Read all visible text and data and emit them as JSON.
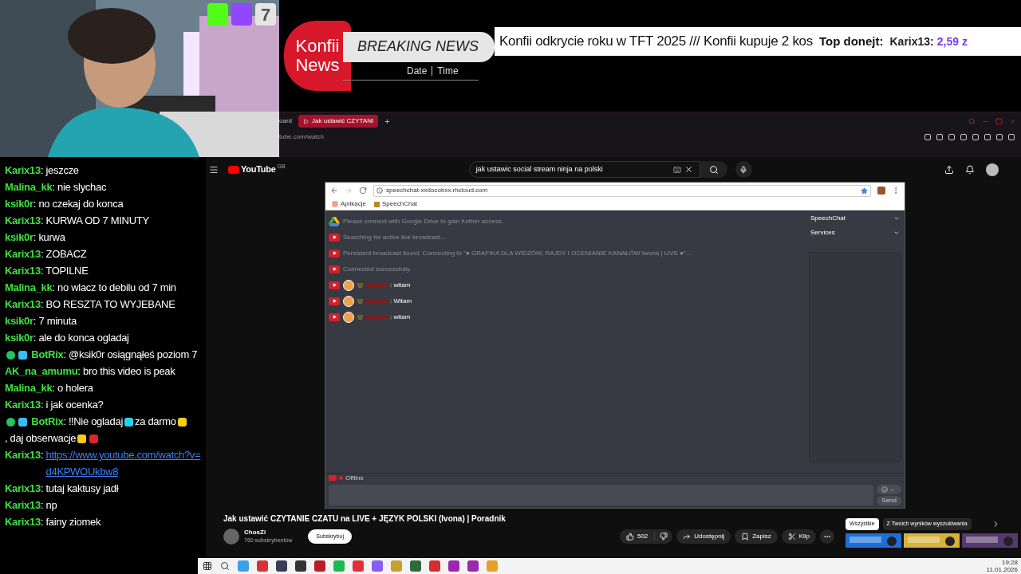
{
  "webcam": {
    "kind": "picture",
    "badge_count": "7"
  },
  "ticker": {
    "brand_top": "Konfii",
    "brand_bottom": "News",
    "headline": "BREAKING NEWS",
    "date": "Date",
    "time": "Time",
    "news": "Konfii odkrycie roku w TFT 2025  /// Konfii kupuje 2 kos",
    "top_label": "Top donejt:",
    "top_name": "Karix13:",
    "top_amount": "2,59 z"
  },
  "browser": {
    "prev_tab": "oard",
    "tabs": [
      {
        "label": "Jak ustawić CZYTANI",
        "selected": true
      }
    ],
    "new_tab": "+",
    "url": "tube.com/watch"
  },
  "chat": [
    {
      "kind": "user",
      "name": "Karix13",
      "text": ": jeszcze"
    },
    {
      "kind": "user",
      "name": "Malina_kk",
      "text": ": nie slychac"
    },
    {
      "kind": "user",
      "name": "ksik0r",
      "text": ": no czekaj do konca"
    },
    {
      "kind": "user",
      "name": "Karix13",
      "text": ": KURWA OD 7 MINUTY"
    },
    {
      "kind": "user",
      "name": "ksik0r",
      "text": ": kurwa"
    },
    {
      "kind": "user",
      "name": "Karix13",
      "text": ": ZOBACZ"
    },
    {
      "kind": "user",
      "name": "Karix13",
      "text": ": TOPILNE"
    },
    {
      "kind": "user",
      "name": "Malina_kk",
      "text": ": no wlacz to debilu od 7 min"
    },
    {
      "kind": "user",
      "name": "Karix13",
      "text": ": BO RESZTA TO WYJEBANE"
    },
    {
      "kind": "user",
      "name": "ksik0r",
      "text": ": 7 minuta"
    },
    {
      "kind": "user",
      "name": "ksik0r",
      "text": ": ale do konca ogladaj"
    },
    {
      "kind": "bot",
      "name": "BotRix",
      "text": ": @ksik0r osiągnąłeś poziom 7"
    },
    {
      "kind": "user",
      "name": "AK_na_amumu",
      "text": ": bro this video is peak"
    },
    {
      "kind": "user",
      "name": "Malina_kk",
      "text": ": o holera"
    },
    {
      "kind": "user",
      "name": "Karix13",
      "text": ": i jak ocenka?"
    },
    {
      "kind": "bot",
      "name": "BotRix",
      "parts": [
        ": ‼Nie ogladaj",
        "za darmo",
        ", daj",
        "obserwacje"
      ]
    },
    {
      "kind": "link",
      "name": "Karix13",
      "text": ":",
      "link": "https://www.youtube.com/watch?v=d4KPWOUkbw8"
    },
    {
      "kind": "user",
      "name": "Karix13",
      "text": ": tutaj kaktusy jadł"
    },
    {
      "kind": "user",
      "name": "Karix13",
      "text": ": np"
    },
    {
      "kind": "user",
      "name": "Karix13",
      "text": ": fainy ziomek"
    }
  ],
  "youtube": {
    "logo": "YouTube",
    "region": "GB",
    "search": "jak ustawic social stream ninja na polski",
    "inner": {
      "url": "speechchat-xxdocobxx.rhcloud.com",
      "bookmarks": [
        "Aplikacje",
        "SpeechChat"
      ],
      "log": [
        {
          "kind": "drive",
          "text": "Please connect with Google Drive to gain further access."
        },
        {
          "kind": "youtube",
          "text": "Searching for active live broadcast..."
        },
        {
          "kind": "youtube",
          "text": "Persistent broadcast found. Connecting to \"● GRAFIKA DLA WIDZÓW, RAJDY I OCENIANIE KANAŁÓW Iwona | LIVE ●\"..."
        },
        {
          "kind": "youtube",
          "text": "Connected successfully."
        },
        {
          "kind": "message",
          "text": ": witam"
        },
        {
          "kind": "message",
          "text": ": Witam"
        },
        {
          "kind": "message",
          "text": ": witam"
        }
      ],
      "menus": [
        "SpeechChat",
        "Services"
      ],
      "status": "Offline",
      "send": "Send"
    },
    "title": "Jak ustawić CZYTANIE CZATU na LIVE + JĘZYK POLSKI (Ivona) | Poradnik",
    "channel": "ChosZi",
    "subscribers": "760 subskrybentów",
    "subscribe": "Subskrybuj",
    "likes": "502",
    "actions": [
      "Udostępnij",
      "Zapisz",
      "Klip"
    ],
    "chips": [
      {
        "label": "Wszystkie",
        "selected": true
      },
      {
        "label": "Z Twoich wyników wyszukiwania",
        "selected": false
      }
    ]
  },
  "taskbar": {
    "time": "19:28",
    "date": "11.01.2026"
  }
}
